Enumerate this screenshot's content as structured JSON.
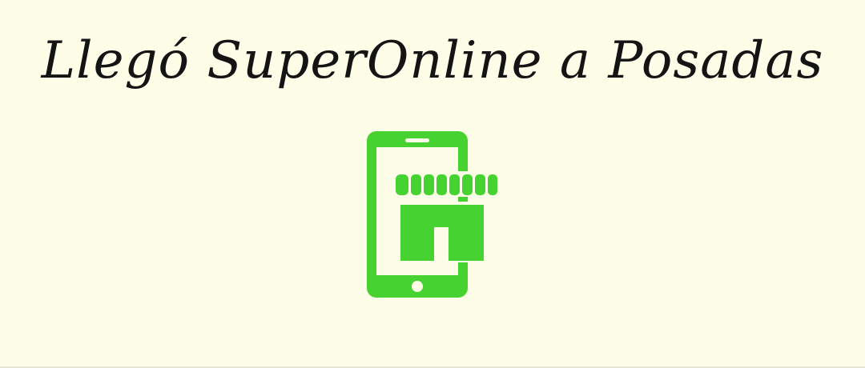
{
  "headline": "Llegó SuperOnline a Posadas",
  "icon": {
    "name": "mobile-store-icon",
    "color": "#46d332"
  },
  "colors": {
    "background": "#fdfde8",
    "text": "#141414"
  }
}
